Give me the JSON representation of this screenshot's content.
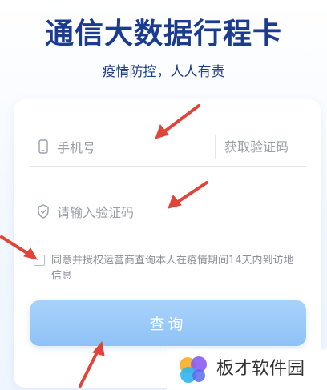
{
  "header": {
    "title": "通信大数据行程卡",
    "subtitle": "疫情防控，人人有责"
  },
  "form": {
    "phone": {
      "placeholder": "手机号",
      "icon": "phone-icon"
    },
    "get_code_label": "获取验证码",
    "code": {
      "placeholder": "请输入验证码",
      "icon": "shield-icon"
    },
    "agreement": {
      "checked": false,
      "text": "同意并授权运营商查询本人在疫情期间14天内到访地信息"
    },
    "submit_label": "查询"
  },
  "watermark": {
    "text": "板才软件园"
  },
  "annotations": {
    "arrow_color": "#e0453a",
    "count": 4
  },
  "colors": {
    "title": "#1a3b8f",
    "button": "#9ccbf9",
    "placeholder": "#9a9ea6"
  }
}
